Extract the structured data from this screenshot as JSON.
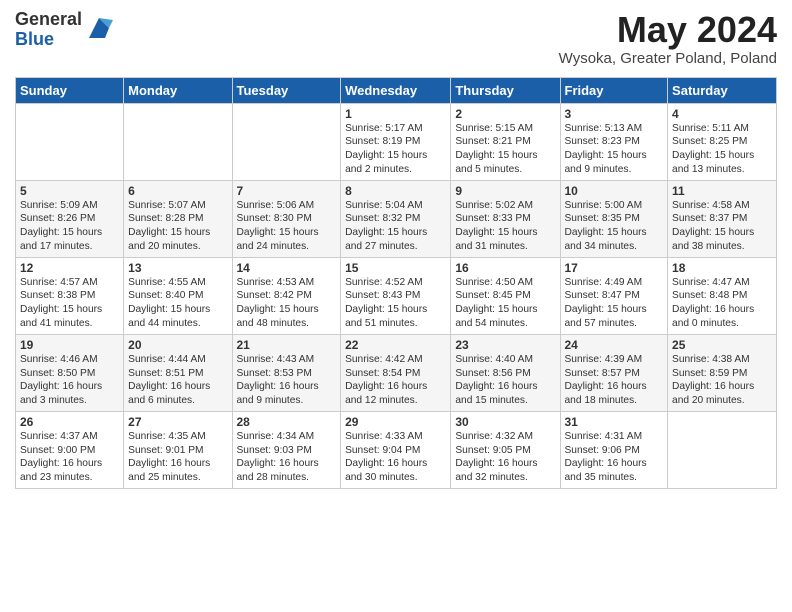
{
  "header": {
    "logo_general": "General",
    "logo_blue": "Blue",
    "month_year": "May 2024",
    "location": "Wysoka, Greater Poland, Poland"
  },
  "days_of_week": [
    "Sunday",
    "Monday",
    "Tuesday",
    "Wednesday",
    "Thursday",
    "Friday",
    "Saturday"
  ],
  "weeks": [
    [
      {
        "day": "",
        "info": ""
      },
      {
        "day": "",
        "info": ""
      },
      {
        "day": "",
        "info": ""
      },
      {
        "day": "1",
        "info": "Sunrise: 5:17 AM\nSunset: 8:19 PM\nDaylight: 15 hours\nand 2 minutes."
      },
      {
        "day": "2",
        "info": "Sunrise: 5:15 AM\nSunset: 8:21 PM\nDaylight: 15 hours\nand 5 minutes."
      },
      {
        "day": "3",
        "info": "Sunrise: 5:13 AM\nSunset: 8:23 PM\nDaylight: 15 hours\nand 9 minutes."
      },
      {
        "day": "4",
        "info": "Sunrise: 5:11 AM\nSunset: 8:25 PM\nDaylight: 15 hours\nand 13 minutes."
      }
    ],
    [
      {
        "day": "5",
        "info": "Sunrise: 5:09 AM\nSunset: 8:26 PM\nDaylight: 15 hours\nand 17 minutes."
      },
      {
        "day": "6",
        "info": "Sunrise: 5:07 AM\nSunset: 8:28 PM\nDaylight: 15 hours\nand 20 minutes."
      },
      {
        "day": "7",
        "info": "Sunrise: 5:06 AM\nSunset: 8:30 PM\nDaylight: 15 hours\nand 24 minutes."
      },
      {
        "day": "8",
        "info": "Sunrise: 5:04 AM\nSunset: 8:32 PM\nDaylight: 15 hours\nand 27 minutes."
      },
      {
        "day": "9",
        "info": "Sunrise: 5:02 AM\nSunset: 8:33 PM\nDaylight: 15 hours\nand 31 minutes."
      },
      {
        "day": "10",
        "info": "Sunrise: 5:00 AM\nSunset: 8:35 PM\nDaylight: 15 hours\nand 34 minutes."
      },
      {
        "day": "11",
        "info": "Sunrise: 4:58 AM\nSunset: 8:37 PM\nDaylight: 15 hours\nand 38 minutes."
      }
    ],
    [
      {
        "day": "12",
        "info": "Sunrise: 4:57 AM\nSunset: 8:38 PM\nDaylight: 15 hours\nand 41 minutes."
      },
      {
        "day": "13",
        "info": "Sunrise: 4:55 AM\nSunset: 8:40 PM\nDaylight: 15 hours\nand 44 minutes."
      },
      {
        "day": "14",
        "info": "Sunrise: 4:53 AM\nSunset: 8:42 PM\nDaylight: 15 hours\nand 48 minutes."
      },
      {
        "day": "15",
        "info": "Sunrise: 4:52 AM\nSunset: 8:43 PM\nDaylight: 15 hours\nand 51 minutes."
      },
      {
        "day": "16",
        "info": "Sunrise: 4:50 AM\nSunset: 8:45 PM\nDaylight: 15 hours\nand 54 minutes."
      },
      {
        "day": "17",
        "info": "Sunrise: 4:49 AM\nSunset: 8:47 PM\nDaylight: 15 hours\nand 57 minutes."
      },
      {
        "day": "18",
        "info": "Sunrise: 4:47 AM\nSunset: 8:48 PM\nDaylight: 16 hours\nand 0 minutes."
      }
    ],
    [
      {
        "day": "19",
        "info": "Sunrise: 4:46 AM\nSunset: 8:50 PM\nDaylight: 16 hours\nand 3 minutes."
      },
      {
        "day": "20",
        "info": "Sunrise: 4:44 AM\nSunset: 8:51 PM\nDaylight: 16 hours\nand 6 minutes."
      },
      {
        "day": "21",
        "info": "Sunrise: 4:43 AM\nSunset: 8:53 PM\nDaylight: 16 hours\nand 9 minutes."
      },
      {
        "day": "22",
        "info": "Sunrise: 4:42 AM\nSunset: 8:54 PM\nDaylight: 16 hours\nand 12 minutes."
      },
      {
        "day": "23",
        "info": "Sunrise: 4:40 AM\nSunset: 8:56 PM\nDaylight: 16 hours\nand 15 minutes."
      },
      {
        "day": "24",
        "info": "Sunrise: 4:39 AM\nSunset: 8:57 PM\nDaylight: 16 hours\nand 18 minutes."
      },
      {
        "day": "25",
        "info": "Sunrise: 4:38 AM\nSunset: 8:59 PM\nDaylight: 16 hours\nand 20 minutes."
      }
    ],
    [
      {
        "day": "26",
        "info": "Sunrise: 4:37 AM\nSunset: 9:00 PM\nDaylight: 16 hours\nand 23 minutes."
      },
      {
        "day": "27",
        "info": "Sunrise: 4:35 AM\nSunset: 9:01 PM\nDaylight: 16 hours\nand 25 minutes."
      },
      {
        "day": "28",
        "info": "Sunrise: 4:34 AM\nSunset: 9:03 PM\nDaylight: 16 hours\nand 28 minutes."
      },
      {
        "day": "29",
        "info": "Sunrise: 4:33 AM\nSunset: 9:04 PM\nDaylight: 16 hours\nand 30 minutes."
      },
      {
        "day": "30",
        "info": "Sunrise: 4:32 AM\nSunset: 9:05 PM\nDaylight: 16 hours\nand 32 minutes."
      },
      {
        "day": "31",
        "info": "Sunrise: 4:31 AM\nSunset: 9:06 PM\nDaylight: 16 hours\nand 35 minutes."
      },
      {
        "day": "",
        "info": ""
      }
    ]
  ]
}
